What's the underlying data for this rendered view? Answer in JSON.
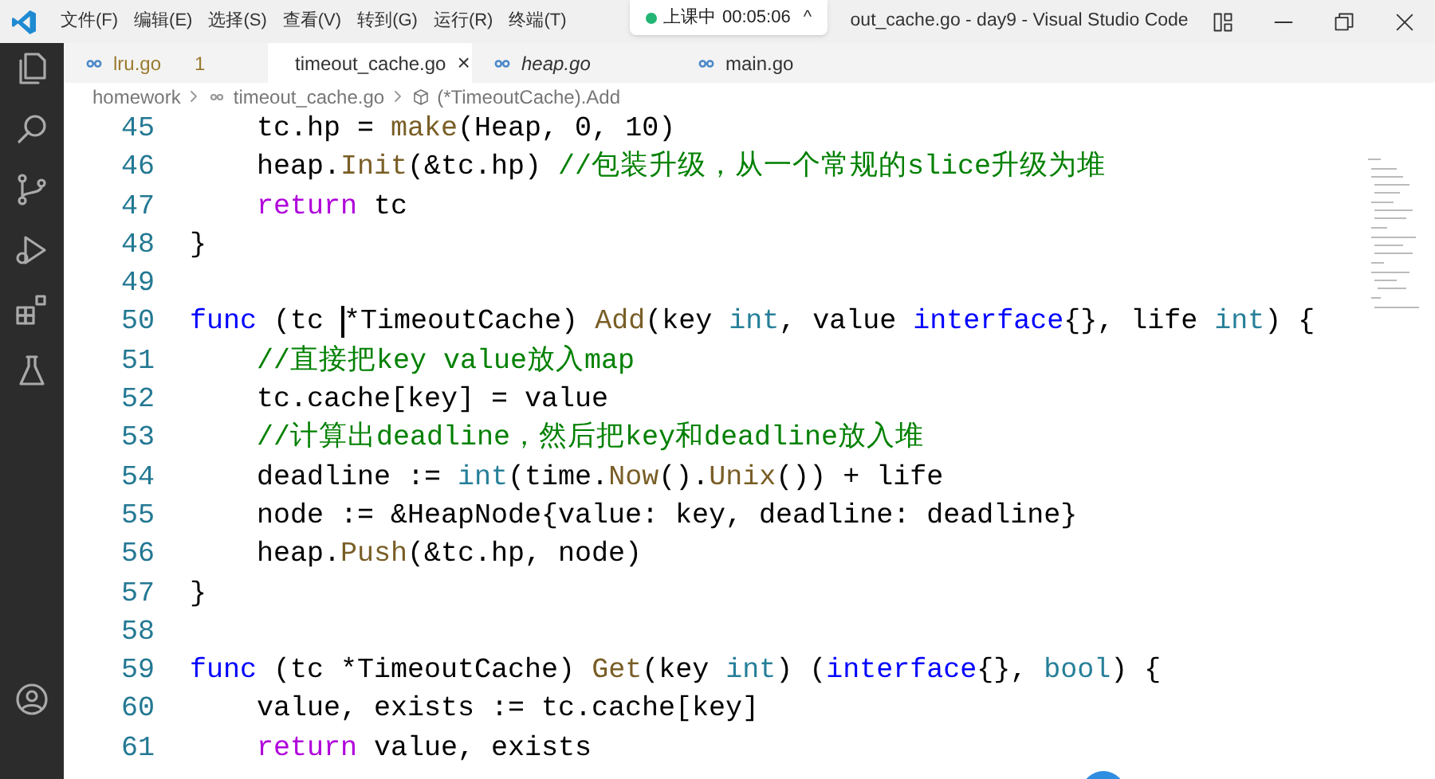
{
  "title_bar": {
    "menu": [
      "文件(F)",
      "编辑(E)",
      "选择(S)",
      "查看(V)",
      "转到(G)",
      "运行(R)",
      "终端(T)"
    ],
    "title": "out_cache.go - day9 - Visual Studio Code"
  },
  "meeting_pill": {
    "status": "上课中",
    "time": "00:05:06",
    "caret": "^"
  },
  "activity_bar": [
    {
      "kind": "files",
      "selected": false
    },
    {
      "kind": "search",
      "selected": false
    },
    {
      "kind": "branch",
      "selected": false
    },
    {
      "kind": "run",
      "selected": false
    },
    {
      "kind": "extensions",
      "selected": false
    },
    {
      "kind": "flask",
      "selected": false
    }
  ],
  "tabs": [
    {
      "label": "lru.go",
      "selected": false,
      "preview": false,
      "warning": true,
      "badge": "1"
    },
    {
      "label": "timeout_cache.go",
      "selected": true,
      "preview": false,
      "warning": false,
      "close": "×"
    },
    {
      "label": "heap.go",
      "selected": false,
      "preview": true,
      "warning": false
    },
    {
      "label": "main.go",
      "selected": false,
      "preview": false,
      "warning": false
    }
  ],
  "breadcrumb": [
    "homework",
    "timeout_cache.go",
    "(*TimeoutCache).Add"
  ],
  "code": [
    {
      "number": "45",
      "tokens": [
        {
          "text": "    tc.hp = ",
          "kind": "plain"
        },
        {
          "text": "make",
          "kind": "func"
        },
        {
          "text": "(Heap, 0, 10)",
          "kind": "plain"
        }
      ]
    },
    {
      "number": "46",
      "tokens": [
        {
          "text": "    heap.",
          "kind": "plain"
        },
        {
          "text": "Init",
          "kind": "func"
        },
        {
          "text": "(&tc.hp) ",
          "kind": "plain"
        },
        {
          "text": "//包装升级，从一个常规的slice升级为堆",
          "kind": "comment"
        }
      ]
    },
    {
      "number": "47",
      "tokens": [
        {
          "text": "    return",
          "kind": "control"
        },
        {
          "text": " tc",
          "kind": "plain"
        }
      ]
    },
    {
      "number": "48",
      "tokens": [
        {
          "text": "}",
          "kind": "plain"
        }
      ]
    },
    {
      "number": "49"
    },
    {
      "number": "50",
      "tokens": [
        {
          "text": "func",
          "kind": "keyword"
        },
        {
          "text": " (tc ",
          "kind": "plain"
        },
        {
          "kind": "cursor"
        },
        {
          "text": "*TimeoutCache) ",
          "kind": "plain"
        },
        {
          "text": "Add",
          "kind": "func"
        },
        {
          "text": "(key ",
          "kind": "plain"
        },
        {
          "text": "int",
          "kind": "type"
        },
        {
          "text": ", value ",
          "kind": "plain"
        },
        {
          "text": "interface",
          "kind": "keyword"
        },
        {
          "text": "{}, life ",
          "kind": "plain"
        },
        {
          "text": "int",
          "kind": "type"
        },
        {
          "text": ") {",
          "kind": "plain"
        }
      ]
    },
    {
      "number": "51",
      "tokens": [
        {
          "text": "    //直接把key value放入map",
          "kind": "comment"
        }
      ]
    },
    {
      "number": "52",
      "tokens": [
        {
          "text": "    tc.cache[key] = value",
          "kind": "plain"
        }
      ]
    },
    {
      "number": "53",
      "tokens": [
        {
          "text": "    //计算出deadline，然后把key和deadline放入堆",
          "kind": "comment"
        }
      ]
    },
    {
      "number": "54",
      "tokens": [
        {
          "text": "    deadline := ",
          "kind": "plain"
        },
        {
          "text": "int",
          "kind": "type"
        },
        {
          "text": "(time.",
          "kind": "plain"
        },
        {
          "text": "Now",
          "kind": "func"
        },
        {
          "text": "().",
          "kind": "plain"
        },
        {
          "text": "Unix",
          "kind": "func"
        },
        {
          "text": "()) + life",
          "kind": "plain"
        }
      ]
    },
    {
      "number": "55",
      "tokens": [
        {
          "text": "    node := &HeapNode{value: key, deadline: deadline}",
          "kind": "plain"
        }
      ]
    },
    {
      "number": "56",
      "tokens": [
        {
          "text": "    heap.",
          "kind": "plain"
        },
        {
          "text": "Push",
          "kind": "func"
        },
        {
          "text": "(&tc.hp, node)",
          "kind": "plain"
        }
      ]
    },
    {
      "number": "57",
      "tokens": [
        {
          "text": "}",
          "kind": "plain"
        }
      ]
    },
    {
      "number": "58"
    },
    {
      "number": "59",
      "tokens": [
        {
          "text": "func",
          "kind": "keyword"
        },
        {
          "text": " (tc *TimeoutCache) ",
          "kind": "plain"
        },
        {
          "text": "Get",
          "kind": "func"
        },
        {
          "text": "(key ",
          "kind": "plain"
        },
        {
          "text": "int",
          "kind": "type"
        },
        {
          "text": ") (",
          "kind": "plain"
        },
        {
          "text": "interface",
          "kind": "keyword"
        },
        {
          "text": "{}, ",
          "kind": "plain"
        },
        {
          "text": "bool",
          "kind": "type"
        },
        {
          "text": ") {",
          "kind": "plain"
        }
      ]
    },
    {
      "number": "60",
      "tokens": [
        {
          "text": "    value, exists := tc.cache[key]",
          "kind": "plain"
        }
      ]
    },
    {
      "number": "61",
      "tokens": [
        {
          "text": "    return",
          "kind": "control"
        },
        {
          "text": " value, exists",
          "kind": "plain"
        }
      ]
    }
  ]
}
